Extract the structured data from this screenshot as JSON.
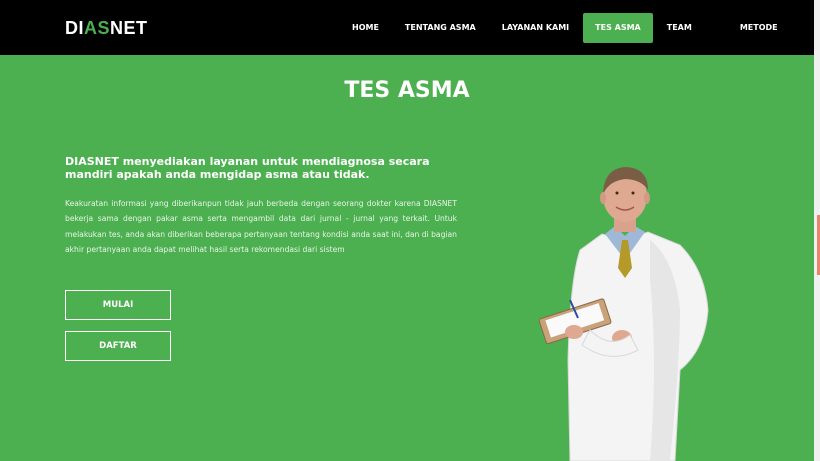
{
  "brand": {
    "logo_prefix": "DI",
    "logo_accent": "AS",
    "logo_suffix": "NET"
  },
  "nav": {
    "items": [
      {
        "label": "HOME",
        "active": false
      },
      {
        "label": "TENTANG ASMA",
        "active": false
      },
      {
        "label": "LAYANAN KAMI",
        "active": false
      },
      {
        "label": "TES ASMA",
        "active": true
      },
      {
        "label": "TEAM",
        "active": false
      },
      {
        "label": "METODE",
        "active": false
      }
    ]
  },
  "main": {
    "title": "TES ASMA",
    "lead": "DIASNET menyediakan layanan untuk mendiagnosa secara mandiri apakah anda mengidap asma atau tidak.",
    "description": "Keakuratan informasi yang diberikanpun tidak jauh berbeda dengan seorang dokter karena DIASNET bekerja sama dengan pakar asma serta mengambil data dari jurnal - jurnal yang terkait. Untuk melakukan tes, anda akan diberikan beberapa pertanyaan tentang kondisi anda saat ini, dan di bagian akhir pertanyaan anda dapat melihat hasil serta rekomendasi dari sistem",
    "start_button": "MULAI",
    "register_button": "DAFTAR"
  },
  "colors": {
    "accent": "#4caf50",
    "navbar": "#000000"
  }
}
